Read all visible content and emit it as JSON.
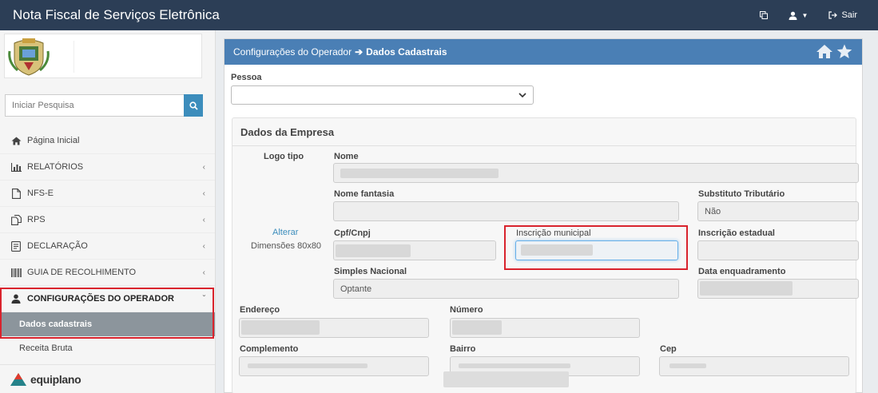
{
  "app": {
    "title": "Nota Fiscal de Serviços Eletrônica"
  },
  "topbar": {
    "copy_icon": "copy-icon",
    "user_icon": "user-icon",
    "logout_label": "Sair"
  },
  "sidebar": {
    "search": {
      "placeholder": "Iniciar Pesquisa"
    },
    "menu": [
      {
        "label": "Página Inicial",
        "icon": "home-icon"
      },
      {
        "label": "RELATÓRIOS",
        "icon": "bar-chart-icon"
      },
      {
        "label": "NFS-E",
        "icon": "file-icon"
      },
      {
        "label": "RPS",
        "icon": "copy-icon"
      },
      {
        "label": "DECLARAÇÃO",
        "icon": "file-text-icon"
      },
      {
        "label": "GUIA DE RECOLHIMENTO",
        "icon": "barcode-icon"
      },
      {
        "label": "CONFIGURAÇÕES DO OPERADOR",
        "icon": "user-icon"
      }
    ],
    "submenu": [
      {
        "label": "Dados cadastrais"
      },
      {
        "label": "Receita Bruta"
      }
    ],
    "footer_brand": "equiplano"
  },
  "panel": {
    "breadcrumb_parent": "Configurações do Operador",
    "breadcrumb_current": "Dados Cadastrais",
    "pessoa_label": "Pessoa"
  },
  "empresa": {
    "title": "Dados da Empresa",
    "logo_label": "Logo tipo",
    "logo_change": "Alterar",
    "logo_dims": "Dimensões 80x80",
    "nome_label": "Nome",
    "nome_fantasia_label": "Nome fantasia",
    "substituto_label": "Substituto Tributário",
    "substituto_value": "Não",
    "cpf_label": "Cpf/Cnpj",
    "inscricao_municipal_label": "Inscrição municipal",
    "inscricao_estadual_label": "Inscrição estadual",
    "simples_label": "Simples Nacional",
    "simples_value": "Optante",
    "data_enquadramento_label": "Data enquadramento",
    "endereco_label": "Endereço",
    "numero_label": "Número",
    "complemento_label": "Complemento",
    "bairro_label": "Bairro",
    "cep_label": "Cep"
  },
  "colors": {
    "header": "#2c3e56",
    "panel_header": "#4a7fb5",
    "highlight": "#d9232d",
    "accent": "#3c8dbc"
  }
}
